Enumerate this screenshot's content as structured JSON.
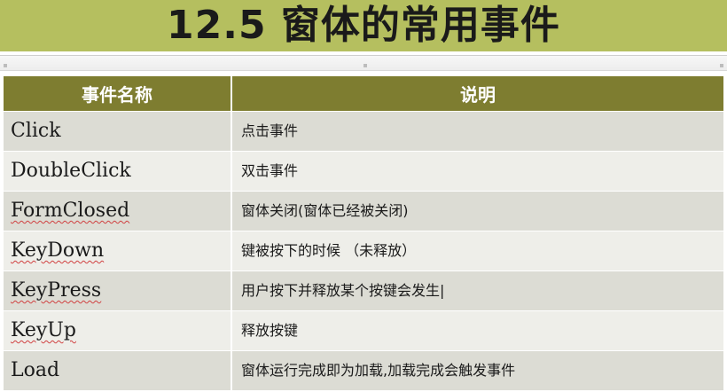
{
  "slide": {
    "title": "12.5 窗体的常用事件"
  },
  "table": {
    "headers": [
      "事件名称",
      "说明"
    ],
    "rows": [
      {
        "name": "Click",
        "desc": "点击事件",
        "spell_flag": false
      },
      {
        "name": "DoubleClick",
        "desc": "双击事件",
        "spell_flag": false
      },
      {
        "name": "FormClosed",
        "desc": "窗体关闭(窗体已经被关闭)",
        "spell_flag": true
      },
      {
        "name": "KeyDown",
        "desc": "键被按下的时候 （未释放）",
        "spell_flag": true
      },
      {
        "name": "KeyPress",
        "desc": "用户按下并释放某个按键会发生|",
        "spell_flag": true
      },
      {
        "name": "KeyUp",
        "desc": "释放按键",
        "spell_flag": true
      },
      {
        "name": "Load",
        "desc": "窗体运行完成即为加载,加载完成会触发事件",
        "spell_flag": false
      }
    ]
  },
  "colors": {
    "title_bar": "#b5bf5f",
    "header_row": "#7e7d30",
    "row_dark": "#dcdcd4",
    "row_light": "#eeeee9",
    "spell_underline": "#d04040"
  }
}
